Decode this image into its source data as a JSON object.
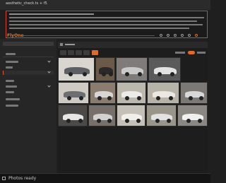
{
  "window": {
    "title": "aesthetic_check.ts + f5"
  },
  "status": {
    "label": "Photos ready"
  },
  "accent": "#e06a2c",
  "highlight_border": "#d9412e",
  "thumbnails": [
    {
      "bg": "#d9d6d0",
      "car": "#5c5f63",
      "name": "thumbnail-1"
    },
    {
      "bg": "#6b5a48",
      "car": "#2b2a2a",
      "name": "thumbnail-2"
    },
    {
      "bg": "#7e7b78",
      "car": "#c9c9c9",
      "name": "thumbnail-3"
    },
    {
      "bg": "#5a5a5a",
      "car": "#e3e3e3",
      "name": "thumbnail-4"
    },
    {
      "bg": "#cfcbc3",
      "car": "#6c6e71",
      "name": "thumbnail-5"
    },
    {
      "bg": "#8a7d70",
      "car": "#d6d6d6",
      "name": "thumbnail-6"
    },
    {
      "bg": "#bdb8ad",
      "car": "#edeaea",
      "name": "thumbnail-7"
    },
    {
      "bg": "#b8b3a8",
      "car": "#ebe7e2",
      "name": "thumbnail-8"
    },
    {
      "bg": "#7c7873",
      "car": "#d8d8d8",
      "name": "thumbnail-9"
    },
    {
      "bg": "#4b4a49",
      "car": "#e6e6e6",
      "name": "thumbnail-10"
    },
    {
      "bg": "#77706a",
      "car": "#d2d2d2",
      "name": "thumbnail-11"
    },
    {
      "bg": "#c4c0b8",
      "car": "#f1efea",
      "name": "thumbnail-12"
    },
    {
      "bg": "#9a958b",
      "car": "#e2e2e2",
      "name": "thumbnail-13"
    },
    {
      "bg": "#8b8782",
      "car": "#f0f0f0",
      "name": "thumbnail-14"
    }
  ]
}
